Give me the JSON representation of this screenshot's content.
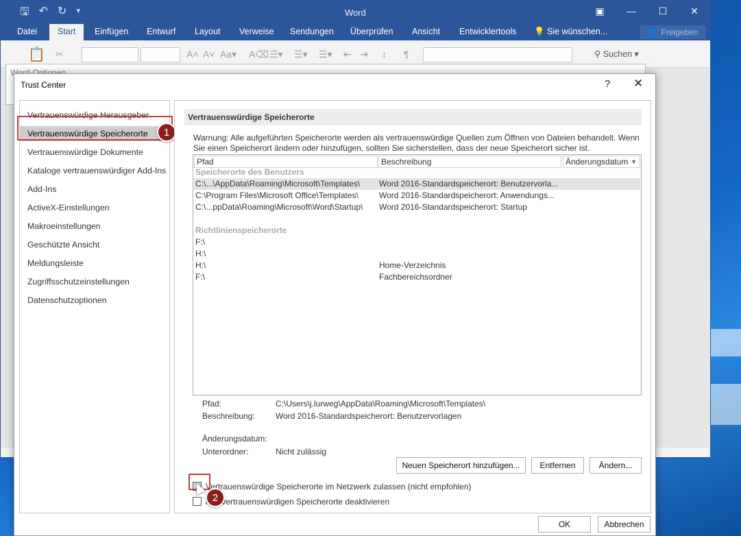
{
  "app": {
    "title": "Word"
  },
  "ribbon": {
    "tabs": [
      "Datei",
      "Start",
      "Einfügen",
      "Entwurf",
      "Layout",
      "Verweise",
      "Sendungen",
      "Überprüfen",
      "Ansicht",
      "Entwicklertools",
      "Sie wünschen..."
    ],
    "active_tab": "Start",
    "share_label": "Freigeben",
    "search_label": "Suchen"
  },
  "word_options": {
    "title": "Word-Optionen"
  },
  "dialog": {
    "title": "Trust Center",
    "help": "?",
    "close": "✕",
    "nav": [
      "Vertrauenswürdige Herausgeber",
      "Vertrauenswürdige Speicherorte",
      "Vertrauenswürdige Dokumente",
      "Kataloge vertrauenswürdiger Add-Ins",
      "Add-Ins",
      "ActiveX-Einstellungen",
      "Makroeinstellungen",
      "Geschützte Ansicht",
      "Meldungsleiste",
      "Zugriffsschutzeinstellungen",
      "Datenschutzoptionen"
    ],
    "selected_nav": "Vertrauenswürdige Speicherorte",
    "section_title": "Vertrauenswürdige Speicherorte",
    "warning": "Warnung: Alle aufgeführten Speicherorte werden als vertrauenswürdige Quellen zum Öffnen von Dateien behandelt. Wenn Sie einen Speicherort ändern oder hinzufügen, sollten Sie sicherstellen, dass der neue Speicherort sicher ist.",
    "columns": {
      "path": "Pfad",
      "description": "Beschreibung",
      "date": "Änderungsdatum"
    },
    "user_group": "Speicherorte des Benutzers",
    "user_rows": [
      {
        "path": "C:\\...\\AppData\\Roaming\\Microsoft\\Templates\\",
        "description": "Word 2016-Standardspeicherort: Benutzervorla..."
      },
      {
        "path": "C:\\Program Files\\Microsoft Office\\Templates\\",
        "description": "Word 2016-Standardspeicherort: Anwendungs..."
      },
      {
        "path": "C:\\...ppData\\Roaming\\Microsoft\\Word\\Startup\\",
        "description": "Word 2016-Standardspeicherort: Startup"
      }
    ],
    "policy_group": "Richtlinienspeicherorte",
    "policy_rows": [
      {
        "path": "F:\\",
        "description": ""
      },
      {
        "path": "H:\\",
        "description": ""
      },
      {
        "path": "H:\\",
        "description": "Home-Verzeichnis"
      },
      {
        "path": "F:\\",
        "description": "Fachbereichsordner"
      }
    ],
    "details": {
      "path_label": "Pfad:",
      "path_value": "C:\\Users\\j.lurweg\\AppData\\Roaming\\Microsoft\\Templates\\",
      "desc_label": "Beschreibung:",
      "desc_value": "Word 2016-Standardspeicherort: Benutzervorlagen",
      "date_label": "Änderungsdatum:",
      "sub_label": "Unterordner:",
      "sub_value": "Nicht zulässig"
    },
    "buttons": {
      "add": "Neuen Speicherort hinzufügen...",
      "remove": "Entfernen",
      "change": "Ändern...",
      "ok": "OK",
      "cancel": "Abbrechen"
    },
    "checkbox_network": "Vertrauenswürdige Speicherorte im Netzwerk zulassen (nicht empfohlen)",
    "checkbox_disable": "Alle vertrauenswürdigen Speicherorte deaktivieren",
    "badges": [
      "1",
      "2"
    ]
  }
}
